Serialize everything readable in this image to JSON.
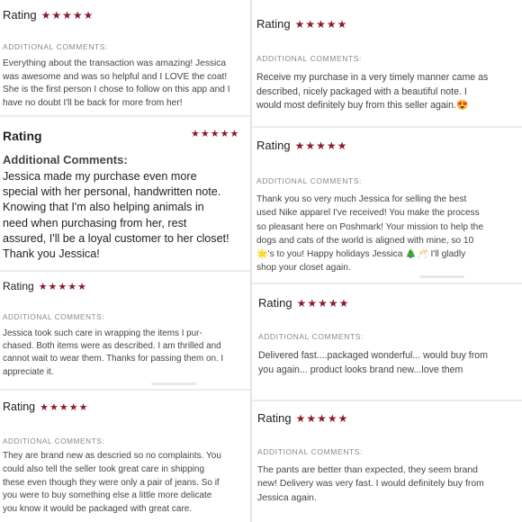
{
  "colors": {
    "star": "#8b1c2c",
    "divider": "#e4e4e4"
  },
  "reviews": [
    {
      "rating_label": "Rating",
      "stars": "★★★★★",
      "heading": "ADDITIONAL COMMENTS:",
      "lines": [
        "Everything about the transaction was amazing! Jessica",
        "was awesome and was so helpful and I LOVE the coat!",
        "She is the first person I chose to follow on this app and I",
        "have no doubt I'll be back for more from her!"
      ]
    },
    {
      "rating_label": "Rating",
      "stars": "★★★★★",
      "heading": "ADDITIONAL COMMENTS:",
      "lines": [
        "Receive my purchase in a very timely manner came as",
        "described, nicely packaged with a beautiful note. I",
        "would most definitely buy from this seller again.😍"
      ]
    },
    {
      "rating_label": "Rating",
      "stars": "★★★★★",
      "heading": "Additional Comments:",
      "lines": [
        "Jessica made my purchase even more",
        "special with her personal, handwritten note.",
        "Knowing that I'm also helping animals in",
        "need when purchasing from her, rest",
        "assured, I'll be a loyal customer to her closet!",
        "Thank you Jessica!"
      ]
    },
    {
      "rating_label": "Rating",
      "stars": "★★★★★",
      "heading": "ADDITIONAL COMMENTS:",
      "lines": [
        "Thank you so very much Jessica for selling the best",
        "used Nike apparel I've received! You make the process",
        "so pleasant here on Poshmark! Your mission to help the",
        "dogs and cats of the world is aligned with mine, so 10",
        "🌟's to you! Happy holidays Jessica 🎄🥂 I'll gladly",
        "shop your closet again."
      ]
    },
    {
      "rating_label": "Rating",
      "stars": "★★★★★",
      "heading": "ADDITIONAL COMMENTS:",
      "lines": [
        "Jessica took such care in wrapping the items I pur-",
        "chased. Both items were as described. I am thrilled and",
        "cannot wait to wear them. Thanks for passing them on. I",
        "appreciate it."
      ]
    },
    {
      "rating_label": "Rating",
      "stars": "★★★★★",
      "heading": "ADDITIONAL COMMENTS:",
      "lines": [
        "Delivered fast....packaged wonderful... would buy from",
        "you again... product looks brand new...love them"
      ]
    },
    {
      "rating_label": "Rating",
      "stars": "★★★★★",
      "heading": "ADDITIONAL COMMENTS:",
      "lines": [
        "They are brand new as descried so no complaints. You",
        "could also tell the seller took great care in shipping",
        "these even though they were only a pair of jeans. So if",
        "you were to buy something else a little more delicate",
        "you know it would be packaged with great care."
      ]
    },
    {
      "rating_label": "Rating",
      "stars": "★★★★★",
      "heading": "ADDITIONAL COMMENTS:",
      "lines": [
        "The pants are better than expected, they seem brand",
        "new! Delivery was very fast. I would definitely buy from",
        "Jessica again."
      ]
    }
  ]
}
